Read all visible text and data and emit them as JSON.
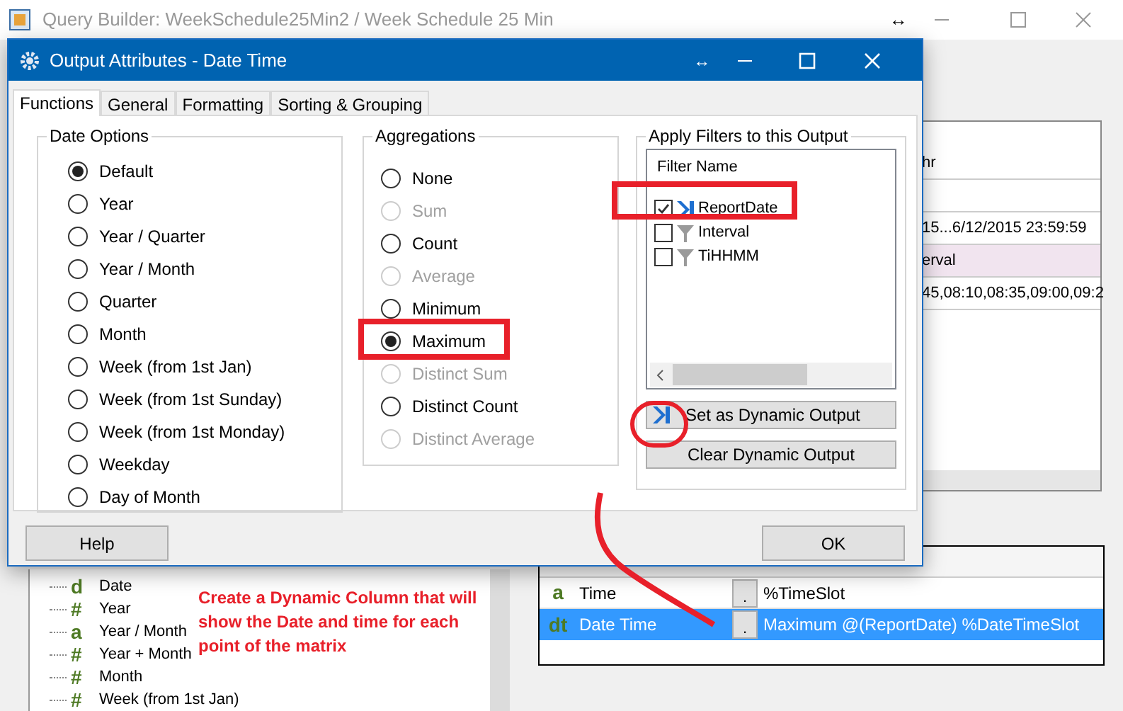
{
  "window": {
    "title": "Query Builder:  WeekSchedule25Min2 / Week Schedule 25 Min",
    "resize_glyph": "↔"
  },
  "background_panel": {
    "rows": [
      {
        "text": "hr",
        "highlighted": false
      },
      {
        "text": "",
        "highlighted": false
      },
      {
        "text": "15...6/12/2015 23:59:59",
        "highlighted": false
      },
      {
        "text": "erval",
        "highlighted": true
      },
      {
        "text": "45,08:10,08:35,09:00,09:2",
        "highlighted": false
      }
    ]
  },
  "tree": {
    "items": [
      {
        "glyph": "d",
        "label": "Date"
      },
      {
        "glyph": "#",
        "label": "Year"
      },
      {
        "glyph": "a",
        "label": "Year / Month"
      },
      {
        "glyph": "#",
        "label": "Year + Month"
      },
      {
        "glyph": "#",
        "label": "Month"
      },
      {
        "glyph": "#",
        "label": "Week (from 1st Jan)"
      }
    ]
  },
  "grid": {
    "rows": [
      {
        "glyph": "a",
        "description": "Time",
        "button": ".",
        "attributes": "%TimeSlot",
        "selected": false
      },
      {
        "glyph": "dt",
        "description": "Date Time",
        "button": ".",
        "attributes": "Maximum @(ReportDate) %DateTimeSlot",
        "selected": true
      }
    ]
  },
  "dialog": {
    "title": "Output Attributes - Date Time",
    "resize_glyph": "↔",
    "tabs": [
      {
        "label": "Functions",
        "selected": true
      },
      {
        "label": "General",
        "selected": false
      },
      {
        "label": "Formatting",
        "selected": false
      },
      {
        "label": "Sorting & Grouping",
        "selected": false
      }
    ],
    "date_options": {
      "title": "Date Options",
      "options": [
        {
          "label": "Default",
          "selected": true
        },
        {
          "label": "Year",
          "selected": false
        },
        {
          "label": "Year / Quarter",
          "selected": false
        },
        {
          "label": "Year / Month",
          "selected": false
        },
        {
          "label": "Quarter",
          "selected": false
        },
        {
          "label": "Month",
          "selected": false
        },
        {
          "label": "Week (from 1st Jan)",
          "selected": false
        },
        {
          "label": "Week (from 1st Sunday)",
          "selected": false
        },
        {
          "label": "Week (from 1st Monday)",
          "selected": false
        },
        {
          "label": "Weekday",
          "selected": false
        },
        {
          "label": "Day of Month",
          "selected": false
        }
      ]
    },
    "aggregations": {
      "title": "Aggregations",
      "options": [
        {
          "label": "None",
          "selected": false,
          "disabled": false
        },
        {
          "label": "Sum",
          "selected": false,
          "disabled": true
        },
        {
          "label": "Count",
          "selected": false,
          "disabled": false
        },
        {
          "label": "Average",
          "selected": false,
          "disabled": true
        },
        {
          "label": "Minimum",
          "selected": false,
          "disabled": false
        },
        {
          "label": "Maximum",
          "selected": true,
          "disabled": false
        },
        {
          "label": "Distinct Sum",
          "selected": false,
          "disabled": true
        },
        {
          "label": "Distinct Count",
          "selected": false,
          "disabled": false
        },
        {
          "label": "Distinct Average",
          "selected": false,
          "disabled": true
        }
      ]
    },
    "filters": {
      "title": "Apply Filters to this Output",
      "header": "Filter Name",
      "items": [
        {
          "label": "ReportDate",
          "checked": true,
          "kind": "dynamic"
        },
        {
          "label": "Interval",
          "checked": false,
          "kind": "filter"
        },
        {
          "label": "TiHHMM",
          "checked": false,
          "kind": "filter"
        }
      ],
      "set_button": "Set as Dynamic Output",
      "clear_button": "Clear Dynamic Output"
    },
    "help_button": "Help",
    "ok_button": "OK"
  },
  "annotation": {
    "text": "Create a Dynamic Column that will show the Date and time for each point of the matrix"
  }
}
